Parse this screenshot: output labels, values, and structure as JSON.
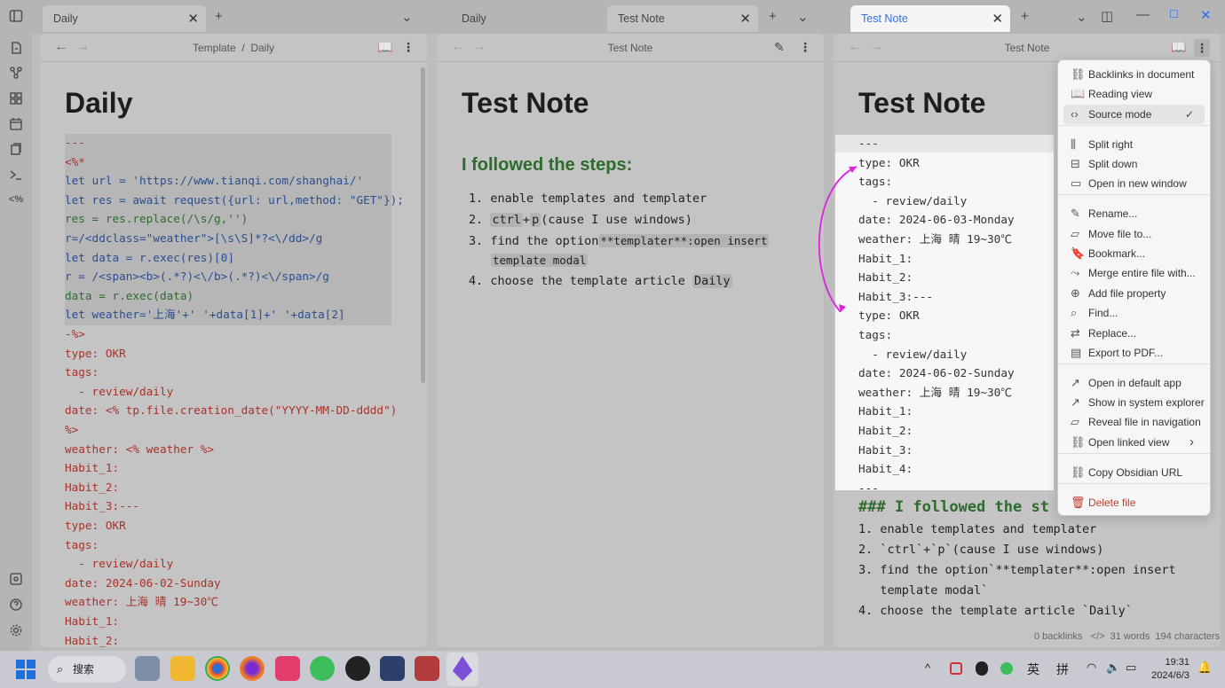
{
  "tabs": {
    "left": {
      "label": "Daily"
    },
    "middle_inactive": {
      "label": "Daily"
    },
    "middle_active": {
      "label": "Test Note"
    },
    "right": {
      "label": "Test Note"
    }
  },
  "left_pane": {
    "breadcrumb": "Template  /  Daily",
    "title": "Daily",
    "lines": [
      "---",
      "<%*",
      "let url = 'https://www.tianqi.com/shanghai/'",
      "let res = await request({url: url,method: \"GET\"});",
      "res = res.replace(/\\s/g,'')",
      "r=/<ddclass=\"weather\">[\\s\\S]*?<\\/dd>/g",
      "let data = r.exec(res)[0]",
      "r = /<span><b>(.*?)<\\/b>(.*?)<\\/span>/g",
      "data = r.exec(data)",
      "let weather='上海'+' '+data[1]+' '+data[2]",
      "-%>",
      "type: OKR",
      "tags:",
      "  - review/daily",
      "date: <% tp.file.creation_date(\"YYYY-MM-DD-dddd\") ",
      "%>",
      "weather: <% weather %>",
      "Habit_1:",
      "Habit_2:",
      "Habit_3:---",
      "type: OKR",
      "tags:",
      "  - review/daily",
      "date: 2024-06-02-Sunday",
      "weather: 上海 晴 19~30℃",
      "Habit_1:",
      "Habit_2:"
    ]
  },
  "middle_pane": {
    "header": "Test Note",
    "title": "Test Note",
    "heading": "I followed the steps:",
    "list": [
      {
        "num": "1.",
        "text": "enable templates and templater"
      },
      {
        "num": "2.",
        "pre": "",
        "k1": "ctrl",
        "mid": "+",
        "k2": "p",
        "post": "(cause I use windows)"
      },
      {
        "num": "3.",
        "text": "find the option",
        "code": "**templater**:open insert",
        "code2": "template modal"
      },
      {
        "num": "4.",
        "text": "choose the template article ",
        "code": "Daily"
      }
    ]
  },
  "right_pane": {
    "header": "Test Note",
    "title": "Test Note",
    "source_lines": [
      "---",
      "type: OKR",
      "tags:",
      "  - review/daily",
      "date: 2024-06-03-Monday",
      "weather: 上海 晴 19~30℃",
      "Habit_1:",
      "Habit_2:",
      "Habit_3:---",
      "type: OKR",
      "tags:",
      "  - review/daily",
      "date: 2024-06-02-Sunday",
      "weather: 上海 晴 19~30℃",
      "Habit_1:",
      "Habit_2:",
      "Habit_3:",
      "Habit_4:",
      "---"
    ],
    "md_heading": "### I followed the st",
    "md_list": [
      "1. enable templates and templater",
      "2. `ctrl`+`p`(cause I use windows)",
      "3. find the option`**templater**:open insert",
      "   template modal`",
      "4. choose the template article `Daily`"
    ],
    "status": {
      "backlinks": "0 backlinks",
      "words": "31 words",
      "chars": "194 characters"
    }
  },
  "menu": {
    "items": [
      {
        "label": "Backlinks in document",
        "icon": "link-icon"
      },
      {
        "label": "Reading view",
        "icon": "book-icon"
      },
      {
        "label": "Source mode",
        "icon": "code-icon",
        "checked": true
      },
      {
        "label": "Split right",
        "icon": "split-right-icon"
      },
      {
        "label": "Split down",
        "icon": "split-down-icon"
      },
      {
        "label": "Open in new window",
        "icon": "window-icon"
      },
      {
        "label": "Rename...",
        "icon": "pencil-icon"
      },
      {
        "label": "Move file to...",
        "icon": "folder-arrow-icon"
      },
      {
        "label": "Bookmark...",
        "icon": "bookmark-icon"
      },
      {
        "label": "Merge entire file with...",
        "icon": "merge-icon"
      },
      {
        "label": "Add file property",
        "icon": "plus-circle-icon"
      },
      {
        "label": "Find...",
        "icon": "search-icon"
      },
      {
        "label": "Replace...",
        "icon": "replace-icon"
      },
      {
        "label": "Export to PDF...",
        "icon": "pdf-icon"
      },
      {
        "label": "Open in default app",
        "icon": "external-icon"
      },
      {
        "label": "Show in system explorer",
        "icon": "external-icon"
      },
      {
        "label": "Reveal file in navigation",
        "icon": "folder-icon"
      },
      {
        "label": "Open linked view",
        "icon": "linked-view-icon"
      },
      {
        "label": "Copy Obsidian URL",
        "icon": "link-icon"
      },
      {
        "label": "Delete file",
        "icon": "trash-icon"
      }
    ]
  },
  "taskbar": {
    "search": "搜索",
    "ime1": "英",
    "ime2": "拼",
    "time": "19:31",
    "date": "2024/6/3"
  },
  "colors": {
    "accent": "#2f6ff0",
    "arrow": "#e020e0",
    "delete": "#c0392b",
    "heading_green": "#2f6b2f"
  }
}
